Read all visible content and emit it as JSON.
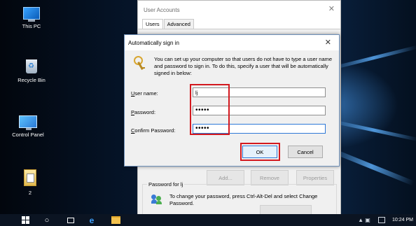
{
  "desktop": {
    "icons": [
      {
        "label": "This PC",
        "icon": "this-pc-icon"
      },
      {
        "label": "Recycle Bin",
        "icon": "recycle-bin-icon"
      },
      {
        "label": "Control Panel",
        "icon": "control-panel-icon"
      },
      {
        "label": "2",
        "icon": "file-icon"
      }
    ]
  },
  "user_accounts": {
    "title": "User Accounts",
    "tabs": [
      "Users",
      "Advanced"
    ],
    "buttons": {
      "add": "Add...",
      "remove": "Remove",
      "properties": "Properties"
    },
    "password_group": {
      "legend": "Password for lj",
      "text": "To change your password, press Ctrl-Alt-Del and select Change Password."
    }
  },
  "auto_signin": {
    "title": "Automatically sign in",
    "info": "You can set up your computer so that users do not have to type a user name and password to sign in. To do this, specify a user that will be automatically signed in below:",
    "fields": {
      "user_name": {
        "label_key": "U",
        "label_rest": "ser name:",
        "value": "lj"
      },
      "password": {
        "label_key": "P",
        "label_rest": "assword:",
        "value": "•••••"
      },
      "confirm_password": {
        "label_key": "C",
        "label_rest": "onfirm Password:",
        "value": "•••••"
      }
    },
    "ok_label": "OK",
    "cancel_label": "Cancel",
    "highlight_color": "#d3191f"
  },
  "taskbar": {
    "clock": "10:24 PM"
  }
}
